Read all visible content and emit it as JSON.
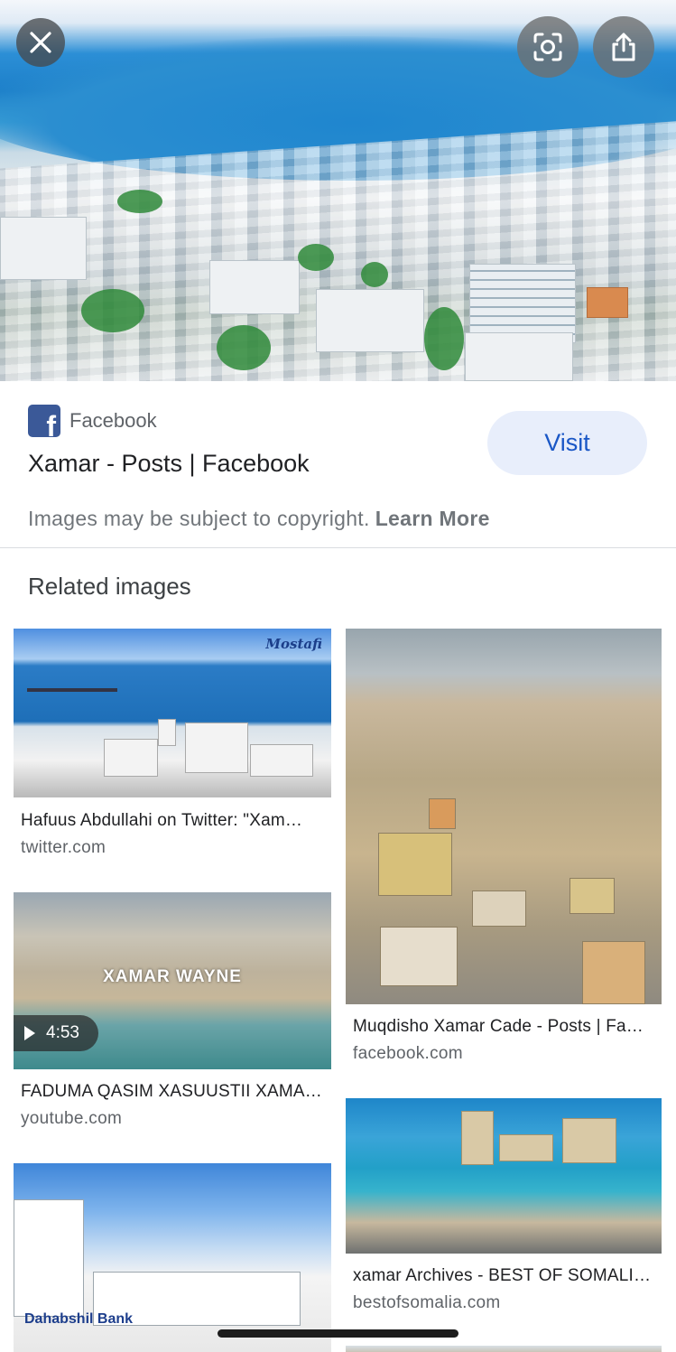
{
  "toolbar": {
    "close_icon": "close-icon",
    "lens_icon": "lens-icon",
    "share_icon": "share-icon"
  },
  "source": {
    "icon": "facebook-icon",
    "name": "Facebook",
    "title": "Xamar - Posts | Facebook",
    "visit_label": "Visit"
  },
  "copyright": {
    "text": "Images may be subject to copyright.",
    "learn_more": "Learn More"
  },
  "related": {
    "heading": "Related images",
    "items": [
      {
        "title": "Hafuus Abdullahi on Twitter: \"Xam…",
        "domain": "twitter.com",
        "watermark": "Mostafi"
      },
      {
        "title": "Muqdisho Xamar Cade - Posts | Fa…",
        "domain": "facebook.com"
      },
      {
        "title": "FADUMA QASIM XASUUSTII XAMA…",
        "domain": "youtube.com",
        "overlay_text": "XAMAR WAYNE",
        "duration": "4:53"
      },
      {
        "title": "xamar Archives - BEST OF SOMALI…",
        "domain": "bestofsomalia.com"
      },
      {
        "sign_text": "Dahabshil Bank"
      }
    ]
  },
  "colors": {
    "accent": "#1a57c6",
    "visit_bg": "#e8eefb",
    "facebook": "#3b5998"
  }
}
